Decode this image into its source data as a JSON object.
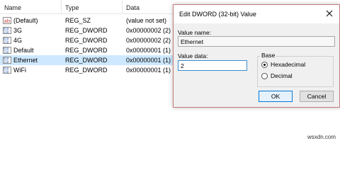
{
  "columns": {
    "name": "Name",
    "type": "Type",
    "data": "Data"
  },
  "rows": [
    {
      "name": "(Default)",
      "type": "REG_SZ",
      "data": "(value not set)",
      "icon": "ab-string-icon",
      "selected": false
    },
    {
      "name": "3G",
      "type": "REG_DWORD",
      "data": "0x00000002 (2)",
      "icon": "binary-value-icon",
      "selected": false
    },
    {
      "name": "4G",
      "type": "REG_DWORD",
      "data": "0x00000002 (2)",
      "icon": "binary-value-icon",
      "selected": false
    },
    {
      "name": "Default",
      "type": "REG_DWORD",
      "data": "0x00000001 (1)",
      "icon": "binary-value-icon",
      "selected": false
    },
    {
      "name": "Ethernet",
      "type": "REG_DWORD",
      "data": "0x00000001 (1)",
      "icon": "binary-value-icon",
      "selected": true
    },
    {
      "name": "WiFi",
      "type": "REG_DWORD",
      "data": "0x00000001 (1)",
      "icon": "binary-value-icon",
      "selected": false
    }
  ],
  "dialog": {
    "title": "Edit DWORD (32-bit) Value",
    "value_name_label": "Value name:",
    "value_name": "Ethernet",
    "value_data_label": "Value data:",
    "value_data": "2",
    "base_label": "Base",
    "hex_label": "Hexadecimal",
    "dec_label": "Decimal",
    "base_selected": "Hexadecimal",
    "ok_label": "OK",
    "cancel_label": "Cancel"
  },
  "watermark": "wsxdn.com",
  "colors": {
    "selection": "#cde8ff",
    "dialog_border": "#c47b7b",
    "focus": "#0078d7"
  }
}
